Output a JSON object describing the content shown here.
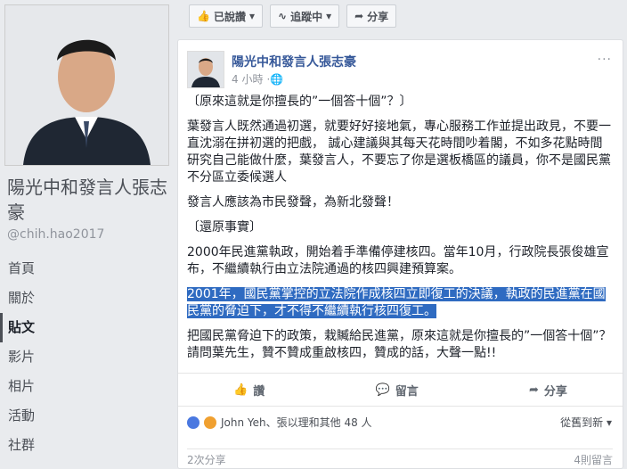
{
  "sidebar": {
    "page_name": "陽光中和發言人張志豪",
    "handle": "@chih.hao2017",
    "nav": [
      "首頁",
      "關於",
      "貼文",
      "影片",
      "相片",
      "活動",
      "社群"
    ],
    "active_index": 2
  },
  "actions": {
    "liked": "已說讚",
    "following": "追蹤中",
    "share": "分享"
  },
  "post": {
    "author": "陽光中和發言人張志豪",
    "time": "4 小時",
    "more": "···",
    "paragraphs": [
      "〔原來這就是你擅長的”一個答十個”？〕",
      "葉發言人既然通過初選，就要好好接地氣，專心服務工作並提出政見，不要一直沈溺在拼初選的把戲， 誠心建議與其每天花時間吵着閣，不如多花點時間研究自己能做什麼，葉發言人，不要忘了你是選板橋區的議員，你不是國民黨不分區立委候選人",
      "發言人應該為市民發聲，為新北發聲！",
      "〔還原事實〕",
      "2000年民進黨執政，開始着手準備停建核四。當年10月，行政院長張俊雄宣布，不繼續執行由立法院通過的核四興建預算案。",
      "2001年，國民黨掌控的立法院作成核四立即復工的決議，執政的民進黨在國民黨的脅迫下，才不得不繼續執行核四復工。",
      "把國民黨脅迫下的政策，栽贓給民進黨，原來這就是你擅長的”一個答十個”？請問葉先生，贊不贊成重啟核四，贊成的話，大聲一點!!"
    ],
    "highlighted_index": 5
  },
  "reactions": {
    "like": "讚",
    "comment": "留言",
    "share": "分享"
  },
  "likers": {
    "text": "John Yeh、張以理和其他 48 人"
  },
  "sort": "從舊到新",
  "footer": {
    "shares": "2次分享",
    "comments": "4則留言"
  }
}
